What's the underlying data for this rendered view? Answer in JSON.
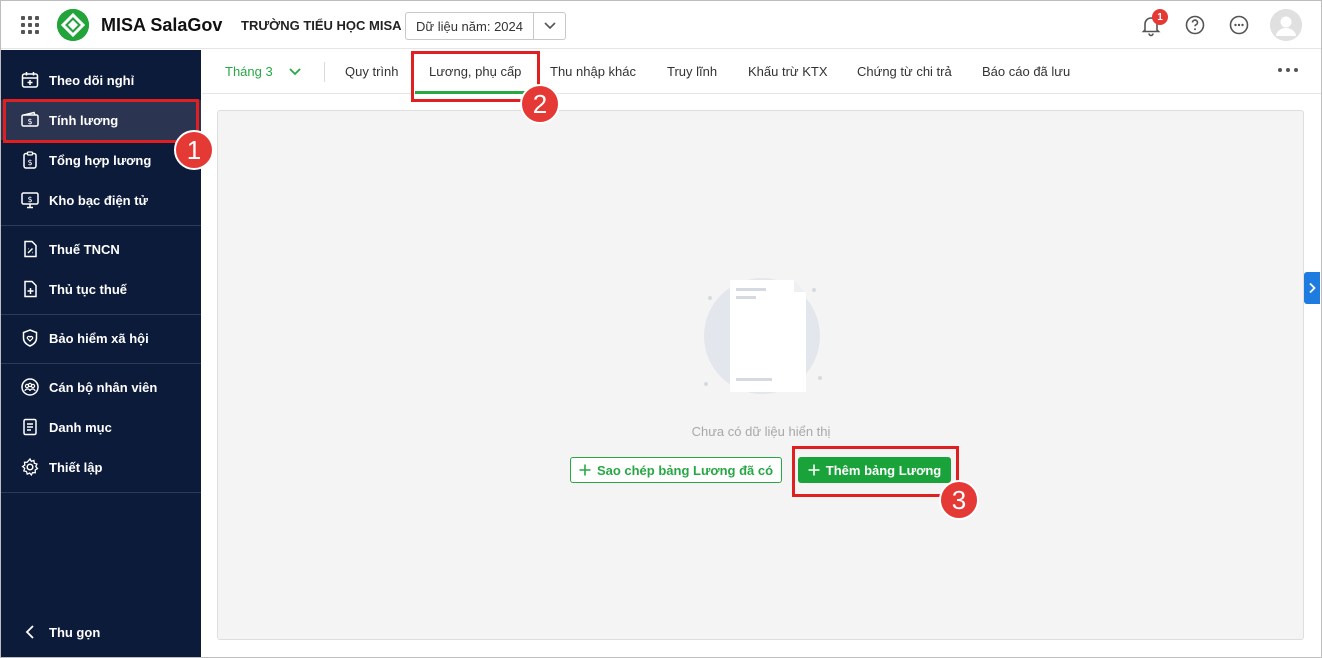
{
  "header": {
    "app_name": "MISA SalaGov",
    "org_name": "TRƯỜNG TIỂU HỌC MISA",
    "year_select": "Dữ liệu năm: 2024",
    "notification_count": "1",
    "brand_color": "#22a43a"
  },
  "sidebar": {
    "items": [
      {
        "label": "Theo dõi nghỉ",
        "icon": "calendar-icon"
      },
      {
        "label": "Tính lương",
        "icon": "money-icon"
      },
      {
        "label": "Tổng hợp lương",
        "icon": "clipboard-dollar-icon"
      },
      {
        "label": "Kho bạc điện tử",
        "icon": "monitor-dollar-icon"
      },
      {
        "label": "Thuế TNCN",
        "icon": "tax-file-icon"
      },
      {
        "label": "Thủ tục thuế",
        "icon": "file-plus-icon"
      },
      {
        "label": "Bảo hiểm xã hội",
        "icon": "shield-heart-icon"
      },
      {
        "label": "Cán bộ nhân viên",
        "icon": "people-icon"
      },
      {
        "label": "Danh mục",
        "icon": "list-doc-icon"
      },
      {
        "label": "Thiết lập",
        "icon": "gear-icon"
      }
    ],
    "collapse_label": "Thu gọn",
    "active_index": 1,
    "background": "#0d1b3a"
  },
  "tabs": {
    "month": "Tháng 3",
    "items": [
      "Quy trình",
      "Lương, phụ cấp",
      "Thu nhập khác",
      "Truy lĩnh",
      "Khấu trừ KTX",
      "Chứng từ chi trả",
      "Báo cáo đã lưu"
    ],
    "active_index": 1
  },
  "main": {
    "empty_text": "Chưa có dữ liệu hiển thị",
    "copy_button": "Sao chép bảng Lương đã có",
    "add_button": "Thêm bảng Lương"
  },
  "annotations": {
    "markers": [
      "1",
      "2",
      "3"
    ],
    "highlight_color": "#e02020"
  }
}
